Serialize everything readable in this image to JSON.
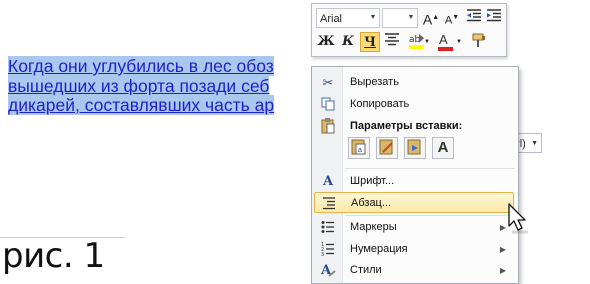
{
  "document": {
    "lines": [
      "Когда они углубились в лес обоз",
      "вышедших из форта позади себ",
      "дикарей, составлявших часть ар"
    ],
    "caption": "рис. 1"
  },
  "mini_toolbar": {
    "font_name": "Arial",
    "font_size": "",
    "grow_font": "A",
    "shrink_font": "A",
    "bold": "Ж",
    "italic": "К",
    "underline": "Ч",
    "font_color_letter": "A"
  },
  "paste_tag": {
    "label": "trl)"
  },
  "context_menu": {
    "items": [
      {
        "label": "Вырезать",
        "icon": "scissors-icon"
      },
      {
        "label": "Копировать",
        "icon": "copy-icon"
      },
      {
        "label": "Параметры вставки:",
        "icon": "paste-icon"
      },
      {
        "label": "Шрифт...",
        "icon": "font-icon"
      },
      {
        "label": "Абзац...",
        "icon": "paragraph-icon"
      },
      {
        "label": "Маркеры",
        "icon": "bullets-icon"
      },
      {
        "label": "Нумерация",
        "icon": "numbering-icon"
      },
      {
        "label": "Стили",
        "icon": "styles-icon"
      }
    ],
    "paste_options": [
      "keep-source-formatting",
      "merge-formatting",
      "paste-picture",
      "keep-text-only"
    ],
    "paste_text_only_letter": "A"
  },
  "colors": {
    "selection": "#aac8ee",
    "text": "#1f1fd0",
    "highlight_yellow": "#fbdc74",
    "font_red": "#e02020"
  }
}
